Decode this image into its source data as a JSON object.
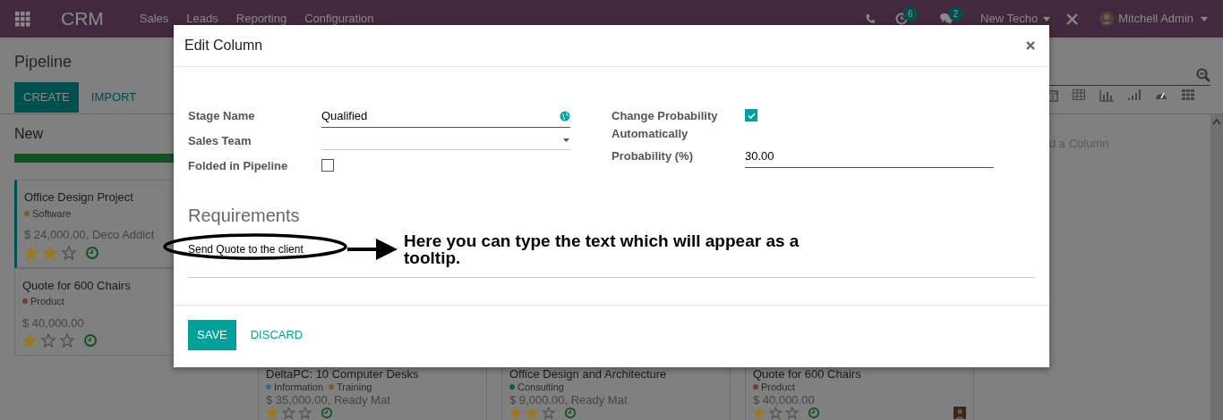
{
  "navbar": {
    "app_name": "CRM",
    "menu": [
      "Sales",
      "Leads",
      "Reporting",
      "Configuration"
    ],
    "activity_count": "6",
    "message_count": "2",
    "company": "New Techo",
    "user": "Mitchell Admin"
  },
  "control_panel": {
    "title": "Pipeline",
    "buttons": [
      {
        "label": "CREATE",
        "kind": "primary"
      },
      {
        "label": "IMPORT",
        "kind": "link"
      }
    ]
  },
  "kanban": {
    "columns": [
      {
        "title": "New",
        "level": 1,
        "cards": [
          {
            "title": "Office Design Project",
            "tags": [
              {
                "label": "Software",
                "color": "#7a5a2a"
              }
            ],
            "amount": "$ 24,000.00, Deco Addict",
            "stars": 2,
            "highlighted": true,
            "avatar": false
          },
          {
            "title": "Quote for 600 Chairs",
            "tags": [
              {
                "label": "Product",
                "color": "#7a3a30"
              }
            ],
            "amount": "$ 40,000.00",
            "stars": 1,
            "highlighted": false,
            "avatar": false
          }
        ]
      },
      {
        "cards": [
          {
            "title": "DeltaPC: 10 Computer Desks",
            "tags": [
              {
                "label": "Information",
                "color": "#3a6a8a"
              },
              {
                "label": "Training",
                "color": "#7a5a2a"
              }
            ],
            "amount": "$ 35,000.00, Ready Mat",
            "stars": 1,
            "highlighted": false,
            "avatar": false
          }
        ]
      },
      {
        "cards": [
          {
            "title": "Office Design and Architecture",
            "tags": [
              {
                "label": "Consulting",
                "color": "#0a5a5a"
              }
            ],
            "amount": "$ 9,000.00, Ready Mat",
            "stars": 2,
            "highlighted": false,
            "avatar": false
          }
        ]
      },
      {
        "cards": [
          {
            "title": "Quote for 600 Chairs",
            "tags": [
              {
                "label": "Product",
                "color": "#7a3a30"
              }
            ],
            "amount": "$ 40,000.00",
            "stars": 1,
            "highlighted": false,
            "avatar": true
          }
        ]
      }
    ],
    "add_column": "d a Column"
  },
  "dialog": {
    "title": "Edit Column",
    "left_fields": [
      {
        "label": "Stage Name",
        "kind": "text",
        "value": "Qualified"
      },
      {
        "label": "Sales Team",
        "kind": "select"
      },
      {
        "label": "Folded in Pipeline",
        "kind": "checkbox",
        "checked": false
      }
    ],
    "right_fields": [
      {
        "label": "Change Probability Automatically",
        "kind": "checkbox",
        "checked": true
      },
      {
        "label": "Probability (%)",
        "kind": "text",
        "value": "30.00"
      }
    ],
    "requirements": {
      "heading": "Requirements",
      "value": "Send Quote to the client"
    },
    "buttons": [
      {
        "label": "SAVE",
        "kind": "primary"
      },
      {
        "label": "DISCARD",
        "kind": "link"
      }
    ]
  },
  "annotation": {
    "text": "Here you can type the text which will appear as a tooltip."
  }
}
